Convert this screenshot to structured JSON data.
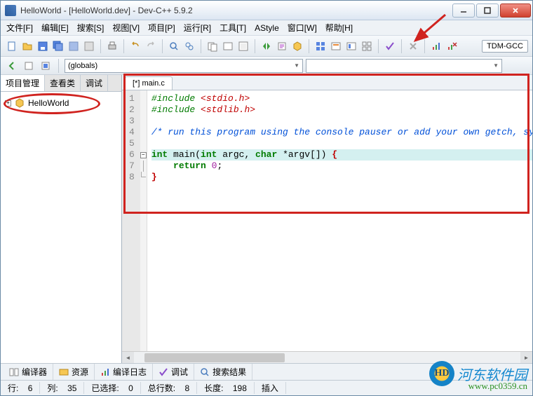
{
  "window": {
    "title": "HelloWorld - [HelloWorld.dev] - Dev-C++ 5.9.2"
  },
  "menu": {
    "file": "文件[F]",
    "edit": "编辑[E]",
    "search": "搜索[S]",
    "view": "视图[V]",
    "project": "项目[P]",
    "run": "运行[R]",
    "tools": "工具[T]",
    "astyle": "AStyle",
    "window": "窗口[W]",
    "help": "帮助[H]"
  },
  "toolbar": {
    "compiler_label": "TDM-GCC"
  },
  "combo": {
    "scope_value": "(globals)"
  },
  "left_tabs": {
    "project": "项目管理",
    "classes": "查看类",
    "debug": "调试"
  },
  "tree": {
    "root": "HelloWorld"
  },
  "editor": {
    "tab": "[*] main.c",
    "line_numbers": [
      "1",
      "2",
      "3",
      "4",
      "5",
      "6",
      "7",
      "8"
    ],
    "l1_pre": "#include ",
    "l1_inc": "<stdio.h>",
    "l2_pre": "#include ",
    "l2_inc": "<stdlib.h>",
    "l4_cm": "/* run this program using the console pauser or add your own getch, system(\"",
    "l6_kw1": "int",
    "l6_kw2": "int",
    "l6_kw3": "char",
    "l6_a": " main(",
    "l6_b": " argc, ",
    "l6_c": " *argv[]) ",
    "l6_d": "{",
    "l7_a": "    ",
    "l7_kw": "return",
    "l7_b": " ",
    "l7_num": "0",
    "l7_c": ";",
    "l8_a": "}"
  },
  "bottom": {
    "compiler": "编译器",
    "resources": "资源",
    "log": "编译日志",
    "debug": "调试",
    "find": "搜索结果"
  },
  "status": {
    "line_lbl": "行:",
    "line_val": "6",
    "col_lbl": "列:",
    "col_val": "35",
    "sel_lbl": "已选择:",
    "sel_val": "0",
    "total_lbl": "总行数:",
    "total_val": "8",
    "len_lbl": "长度:",
    "len_val": "198",
    "mode": "插入"
  },
  "watermark": {
    "text": "河东软件园",
    "url": "www.pc0359.cn",
    "logo": "HD"
  }
}
